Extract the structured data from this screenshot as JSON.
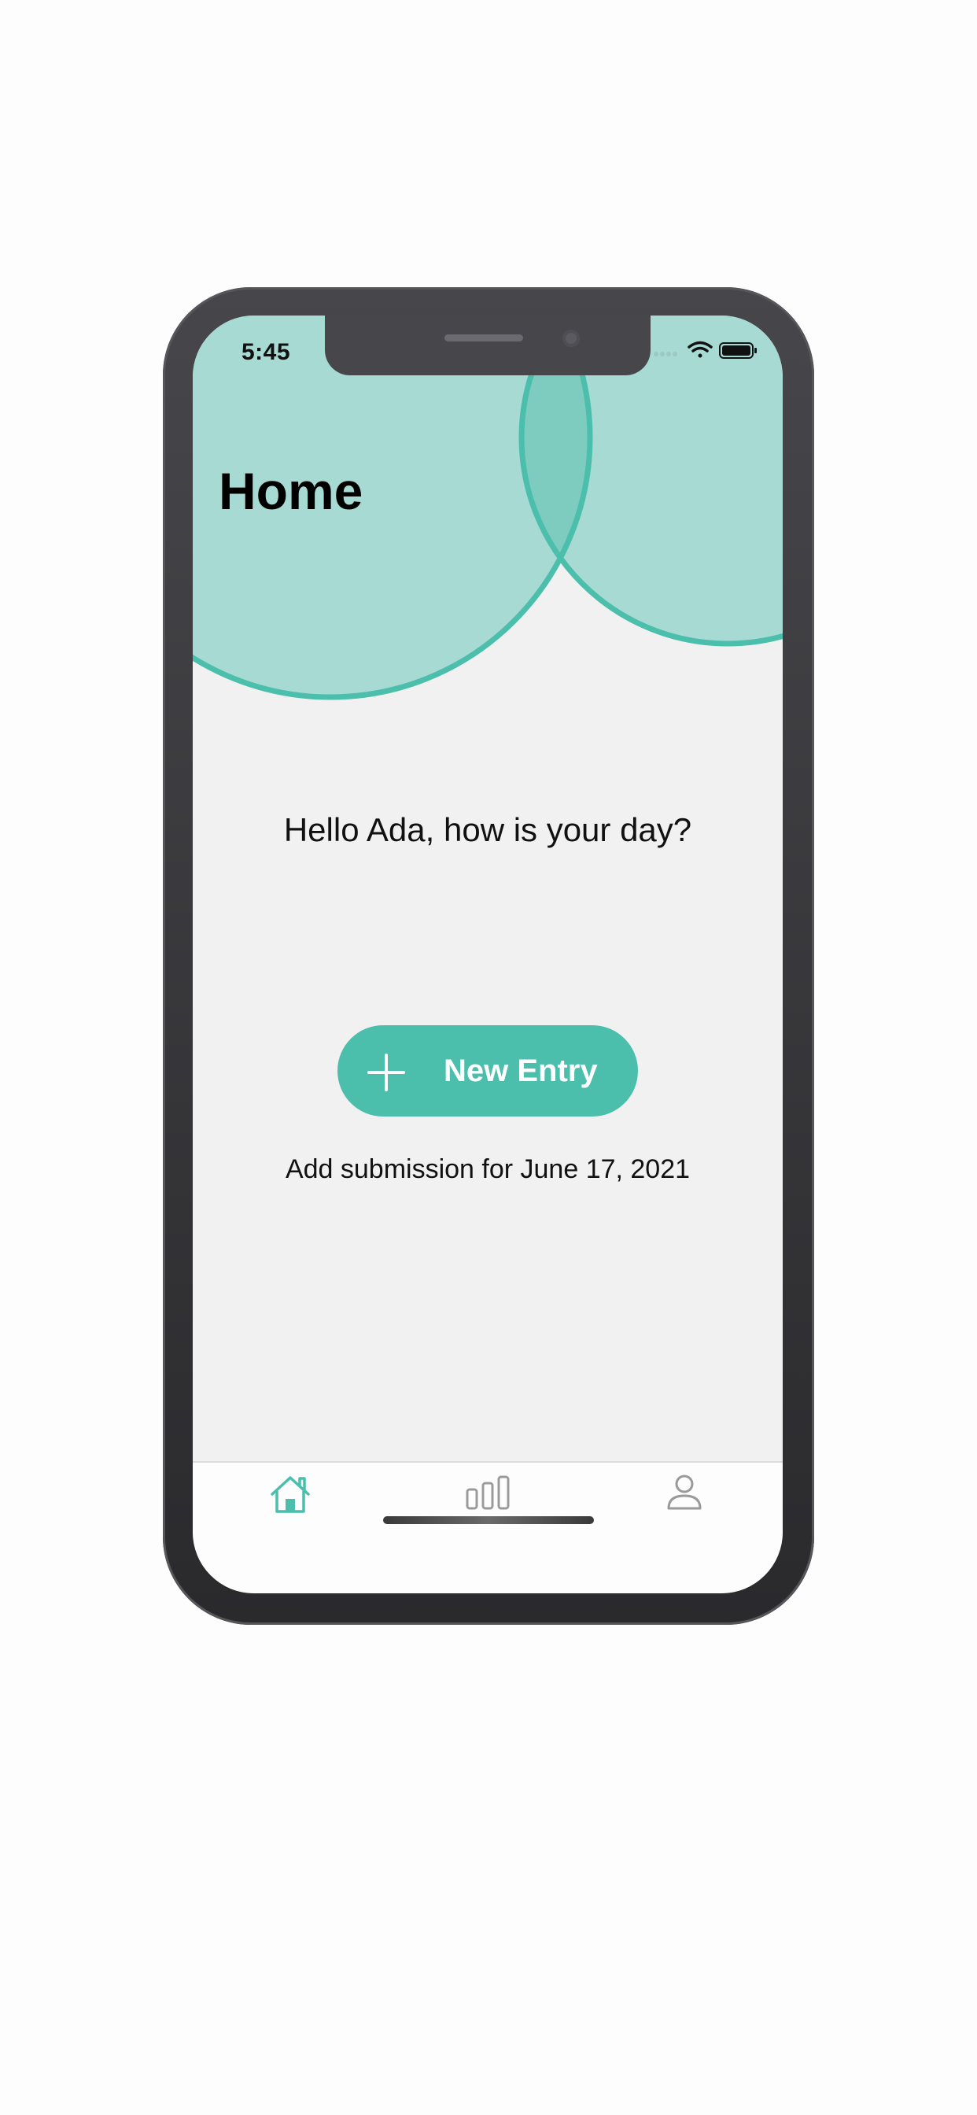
{
  "status_bar": {
    "time": "5:45"
  },
  "header": {
    "title": "Home"
  },
  "main": {
    "greeting": "Hello Ada, how is your day?",
    "new_entry_label": "New Entry",
    "submission_note": "Add submission for June 17, 2021"
  },
  "tab_bar": {
    "items": [
      {
        "icon": "home-icon",
        "active": true
      },
      {
        "icon": "bar-chart-icon",
        "active": false
      },
      {
        "icon": "person-icon",
        "active": false
      }
    ]
  },
  "colors": {
    "accent": "#4bbfac",
    "circle_fill": "#a8dad4",
    "circle_overlap": "#7ecbbf",
    "screen_background": "#f1f1f1",
    "tab_inactive": "#9a9a9a"
  }
}
